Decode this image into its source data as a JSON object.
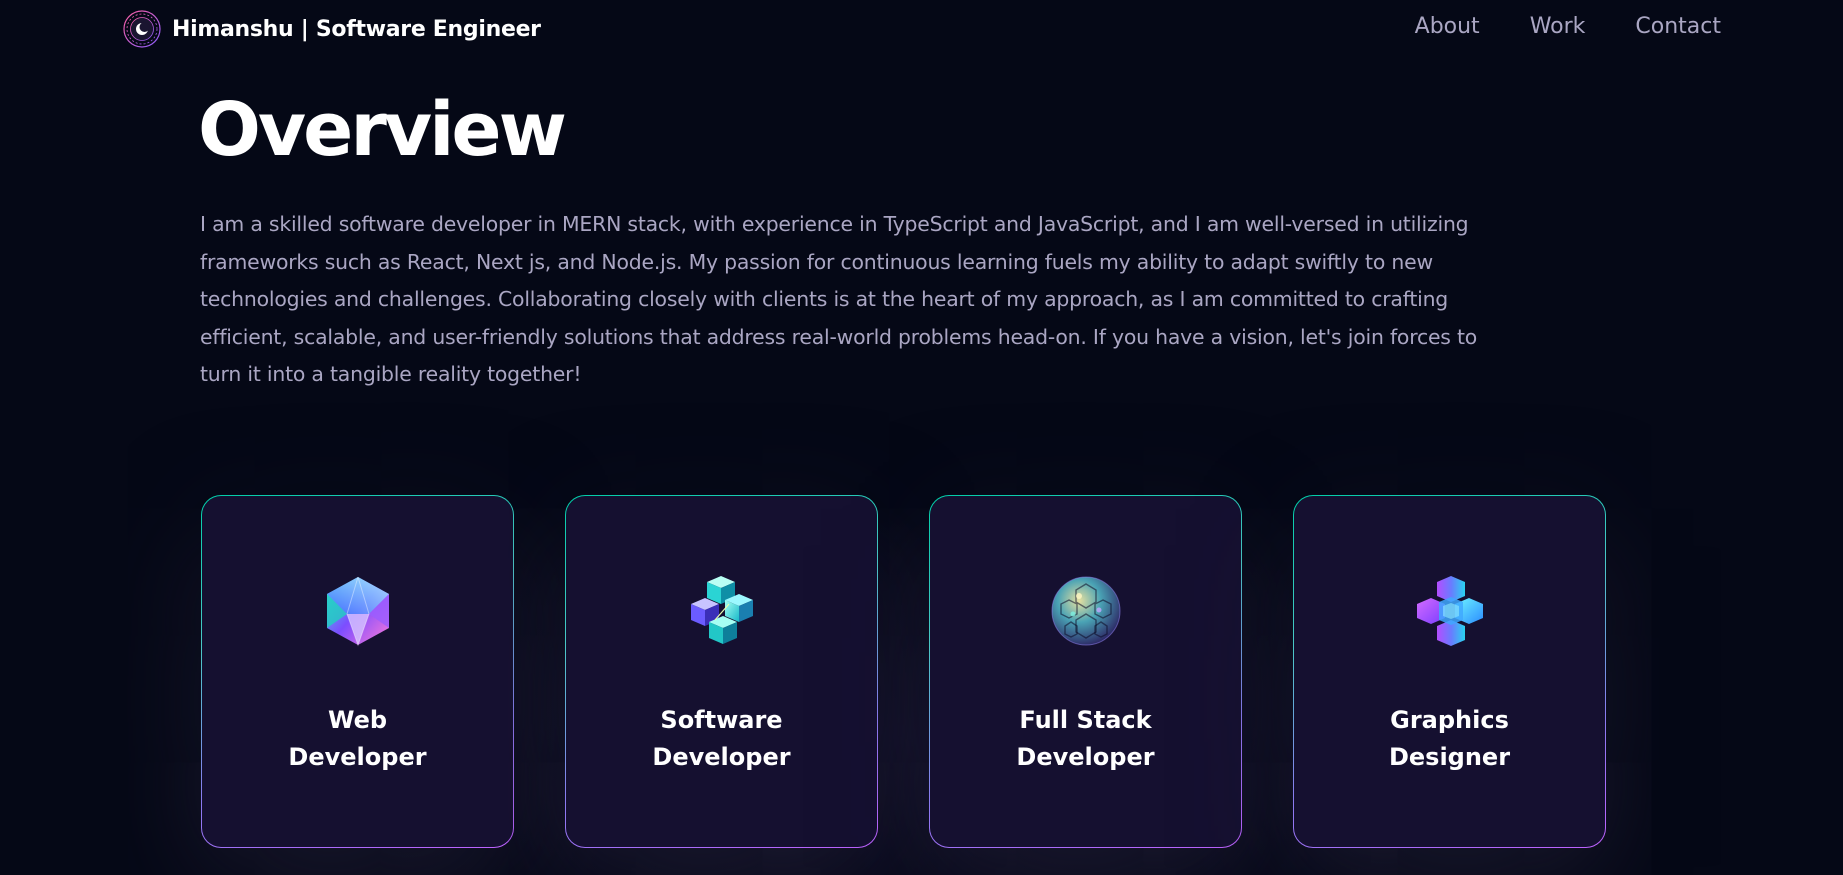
{
  "navbar": {
    "brand": "Himanshu | Software Engineer",
    "logo_icon": "moon-logo-icon",
    "links": [
      {
        "label": "About"
      },
      {
        "label": "Work"
      },
      {
        "label": "Contact"
      }
    ]
  },
  "overview": {
    "title": "Overview",
    "text": "I am a skilled software developer in MERN stack, with experience in TypeScript and JavaScript, and I am well-versed in utilizing frameworks such as React, Next js, and Node.js. My passion for continuous learning fuels my ability to adapt swiftly to new technologies and challenges. Collaborating closely with clients is at the heart of my approach, as I am committed to crafting efficient, scalable, and user-friendly solutions that address real-world problems head-on. If you have a vision, let's join forces to turn it into a tangible reality together!"
  },
  "services": [
    {
      "title": "Web\nDeveloper",
      "icon": "icosahedron-icon"
    },
    {
      "title": "Software\nDeveloper",
      "icon": "cube-cluster-icon"
    },
    {
      "title": "Full Stack\nDeveloper",
      "icon": "sphere-icon"
    },
    {
      "title": "Graphics\nDesigner",
      "icon": "hexagon-cluster-icon"
    }
  ],
  "colors": {
    "background": "#050816",
    "card": "#151030",
    "secondary_text": "#aaa6c3",
    "border_start": "#00cea8",
    "border_end": "#bf61ff"
  }
}
